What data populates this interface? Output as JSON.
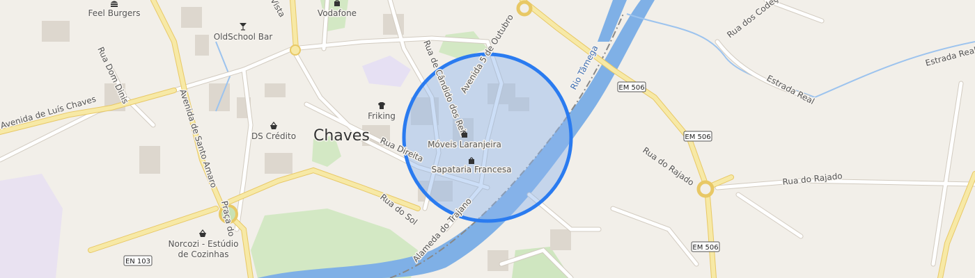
{
  "map": {
    "city_label": "Chaves",
    "accuracy_circle": {
      "stroke_color": "#2a7bf0",
      "fill_color": "#8eb5ee"
    },
    "colors": {
      "land": "#f2efe9",
      "minor_road": "#ffffff",
      "major_road": "#f7e9a6",
      "major_road_casing": "#e8c865",
      "river": "#7fb0e6",
      "park": "#d3e8c4",
      "building": "#ddd7ce",
      "campus": "#e6e0f3"
    },
    "streets": {
      "rua_dom_dinis": "Rua Dom Dinis",
      "avenida_luis_chaves": "Avenida de Luís Chaves",
      "avenida_santo_amaro": "Avenida de Santo Amaro",
      "praca": "Praça do",
      "rua_candido_reis": "Rua de Cândido dos Reis",
      "avenida_5_outubro": "Avenida 5 de Outubro",
      "rua_direita": "Rua Direita",
      "rua_do_sol": "Rua do Sol",
      "alameda_trajano": "Alameda do Trajano",
      "rio_tamega": "Rio Tâmega",
      "rua_dos_codes": "Rua dos Codeç",
      "estrada_real_1": "Estrada Real",
      "estrada_real_2": "Estrada Real",
      "rua_rajado_1": "Rua do Rajado",
      "rua_rajado_2": "Rua do Rajado",
      "rua_vista": "Vista"
    },
    "shields": {
      "em506_a": "EM 506",
      "em506_b": "EM 506",
      "em506_c": "EM 506",
      "en103": "EN 103"
    },
    "pois": [
      {
        "id": "feel-burgers",
        "label": "Feel Burgers",
        "icon": "hamburger-icon"
      },
      {
        "id": "vodafone",
        "label": "Vodafone",
        "icon": "shopping-bag-icon"
      },
      {
        "id": "oldschool-bar",
        "label": "OldSchool Bar",
        "icon": "cocktail-icon"
      },
      {
        "id": "friking",
        "label": "Friking",
        "icon": "tshirt-icon"
      },
      {
        "id": "ds-credito",
        "label": "DS Crédito",
        "icon": "shopping-basket-icon"
      },
      {
        "id": "moveis-laranjeira",
        "label": "Móveis Laranjeira",
        "icon": "shopping-bag-icon"
      },
      {
        "id": "sapataria-francesa",
        "label": "Sapataria Francesa",
        "icon": "shopping-bag-icon"
      },
      {
        "id": "norcozi-line1",
        "label": "Norcozi - Estúdio",
        "icon": "shopping-basket-icon"
      },
      {
        "id": "norcozi-line2",
        "label": "de Cozinhas",
        "icon": ""
      }
    ]
  }
}
